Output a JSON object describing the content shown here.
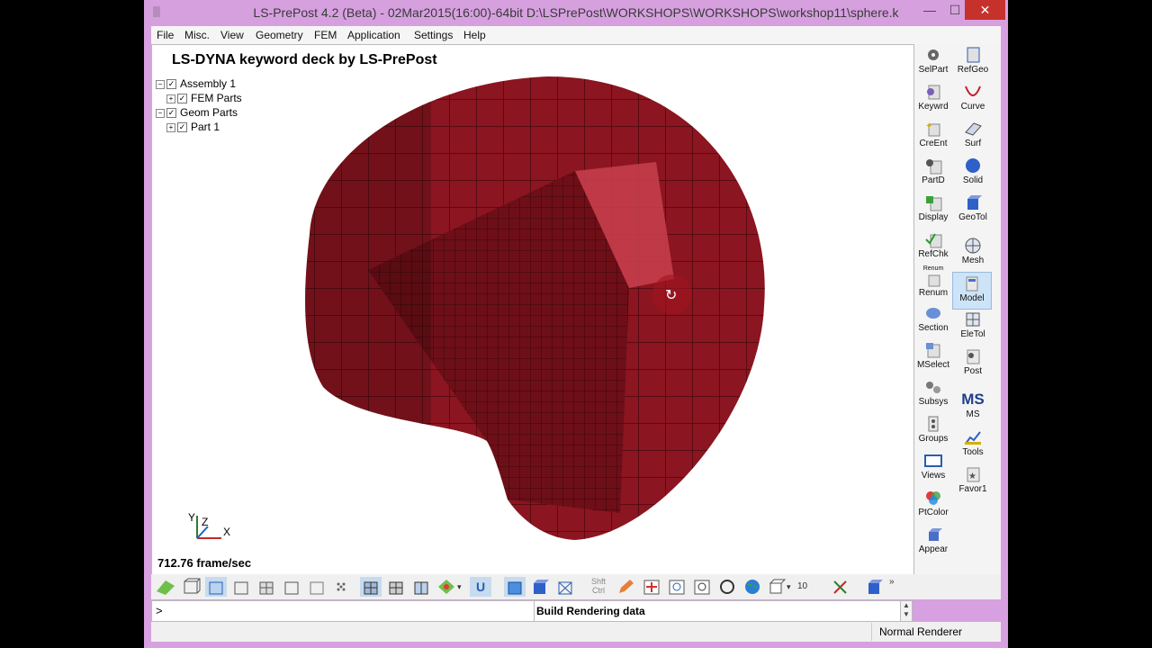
{
  "window": {
    "title": "LS-PrePost 4.2 (Beta) - 02Mar2015(16:00)-64bit D:\\LSPrePost\\WORKSHOPS\\WORKSHOPS\\workshop11\\sphere.k",
    "min": "—",
    "max": "☐",
    "close": "✕"
  },
  "menu": [
    "File",
    "Misc.",
    "View",
    "Geometry",
    "FEM",
    "Application",
    "Settings",
    "Help"
  ],
  "viewport": {
    "title": "LS-DYNA keyword deck by LS-PrePost",
    "fps": "712.76 frame/sec",
    "axes": {
      "y": "Y",
      "z": "Z",
      "x": "X"
    }
  },
  "tree": [
    {
      "label": "Assembly 1"
    },
    {
      "label": "FEM Parts"
    },
    {
      "label": "Geom Parts"
    },
    {
      "label": "Part 1"
    }
  ],
  "right_panel": {
    "col1": [
      "SelPart",
      "Keywrd",
      "CreEnt",
      "PartD",
      "Display",
      "RefChk",
      "Renum",
      "Section",
      "MSelect",
      "Subsys",
      "Groups",
      "Views",
      "PtColor",
      "Appear"
    ],
    "col2": [
      "RefGeo",
      "Curve",
      "Surf",
      "Solid",
      "GeoTol",
      "Mesh",
      "Model",
      "EleTol",
      "Post",
      "MS",
      "Tools",
      "Favor1"
    ],
    "renum_badge": "Renum",
    "ms_logo": "MS"
  },
  "toolbar": {
    "shift_ctrl_line1": "Shft",
    "shift_ctrl_line2": "Ctrl",
    "u_label": "U",
    "zoom_value": "10"
  },
  "command": {
    "prompt": ">",
    "message": "Build Rendering data"
  },
  "status": {
    "renderer": "Normal Renderer"
  },
  "colors": {
    "model": "#8b1520",
    "model_highlight": "#c9404f",
    "window_frame": "#d7a0e0",
    "close_button": "#c7312b"
  }
}
